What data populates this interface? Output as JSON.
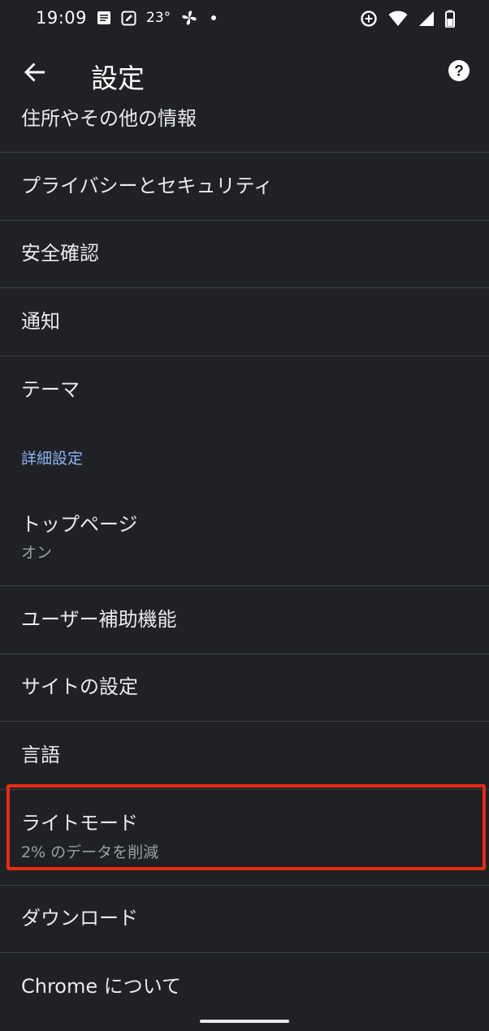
{
  "status_bar": {
    "time": "19:09",
    "temperature": "23°",
    "icons_left": [
      "notes-icon",
      "edit-square-icon",
      "weather-icon",
      "pinwheel-icon",
      "dot-icon"
    ],
    "icons_right": [
      "data-saver-icon",
      "wifi-icon",
      "signal-icon",
      "battery-icon"
    ]
  },
  "app_bar": {
    "title": "設定",
    "back_icon": "arrow-back-icon",
    "help_icon": "help-circle-icon"
  },
  "settings": {
    "items_top": [
      {
        "label": "住所やその他の情報"
      },
      {
        "label": "プライバシーとセキュリティ"
      },
      {
        "label": "安全確認"
      },
      {
        "label": "通知"
      },
      {
        "label": "テーマ"
      }
    ],
    "advanced_header": "詳細設定",
    "items_advanced": [
      {
        "label": "トップページ",
        "sub": "オン"
      },
      {
        "label": "ユーザー補助機能"
      },
      {
        "label": "サイトの設定"
      },
      {
        "label": "言語"
      },
      {
        "label": "ライトモード",
        "sub": "2% のデータを削減"
      },
      {
        "label": "ダウンロード"
      },
      {
        "label": "Chrome について"
      }
    ]
  },
  "colors": {
    "background": "#202124",
    "divider": "#3c4043",
    "accent": "#8ab4f8",
    "highlight": "#ea2a14"
  }
}
